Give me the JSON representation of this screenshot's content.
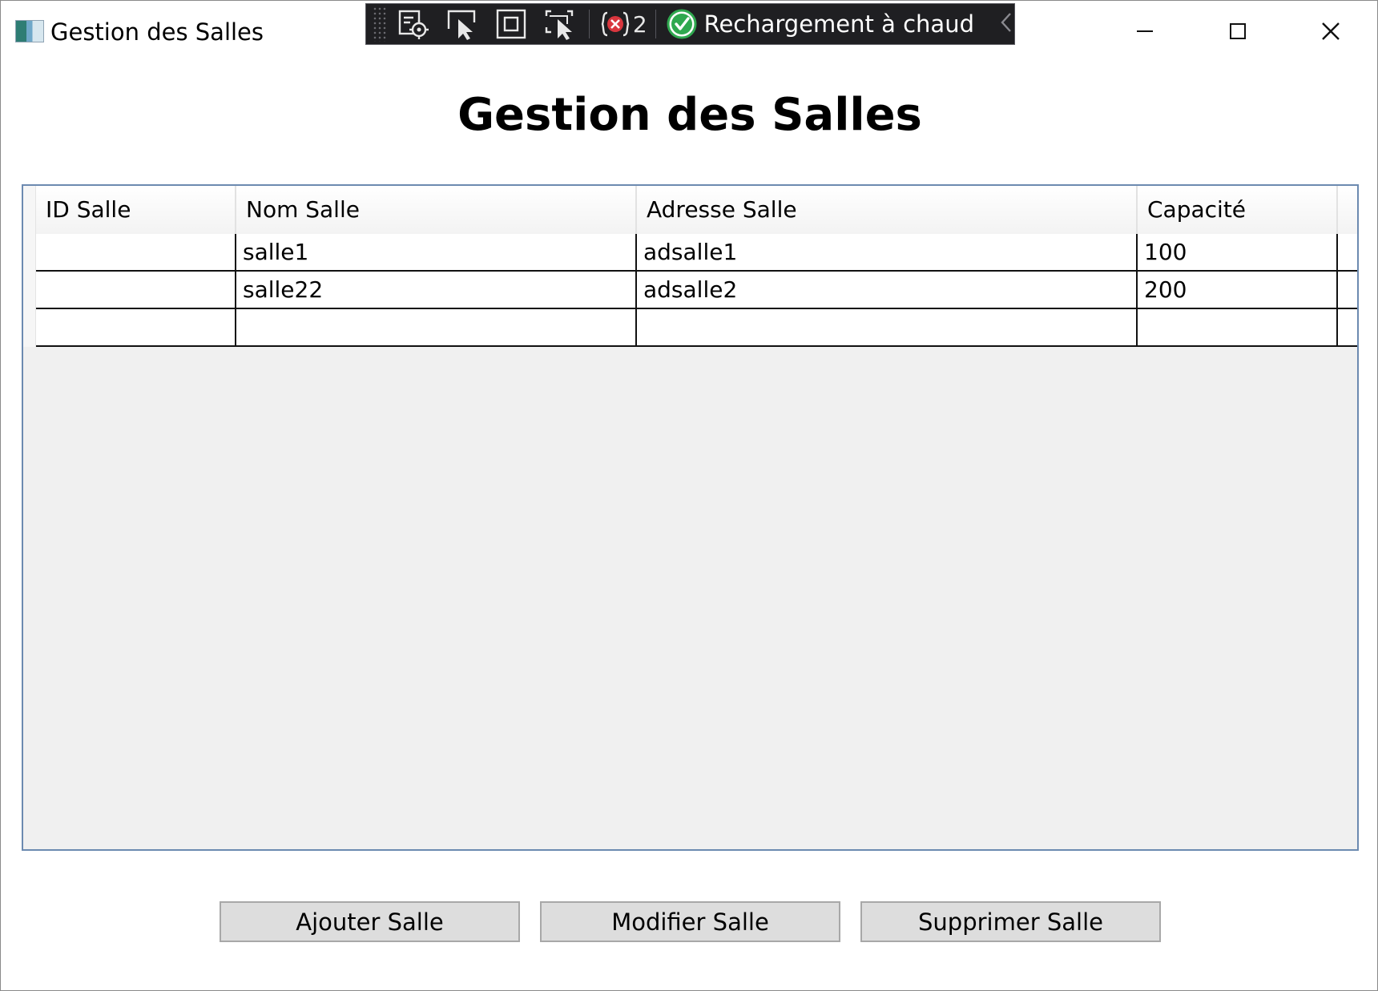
{
  "window": {
    "title": "Gestion des Salles"
  },
  "debug_toolbar": {
    "error_count": "2",
    "hot_reload_label": "Rechargement à chaud",
    "icons": [
      "select-element-icon",
      "select-mode-icon",
      "display-layout-adorners-icon",
      "track-focus-icon",
      "binding-errors-icon",
      "hot-reload-ok-icon",
      "collapse-chevron-icon"
    ]
  },
  "page": {
    "title": "Gestion des Salles"
  },
  "grid": {
    "columns": [
      "ID Salle",
      "Nom Salle",
      "Adresse Salle",
      "Capacité"
    ],
    "rows": [
      [
        "",
        "salle1",
        "adsalle1",
        "100"
      ],
      [
        "",
        "salle22",
        "adsalle2",
        "200"
      ],
      [
        "",
        "",
        "",
        ""
      ]
    ]
  },
  "buttons": {
    "add": "Ajouter Salle",
    "edit": "Modifier Salle",
    "delete": "Supprimer Salle"
  },
  "colors": {
    "toolbar_bg": "#1f1f22",
    "grid_border": "#6c8ab0",
    "grid_bg": "#f0f0f0",
    "button_bg": "#dddddd",
    "hot_reload_ok": "#2fa84f",
    "error_badge": "#d9363e"
  }
}
